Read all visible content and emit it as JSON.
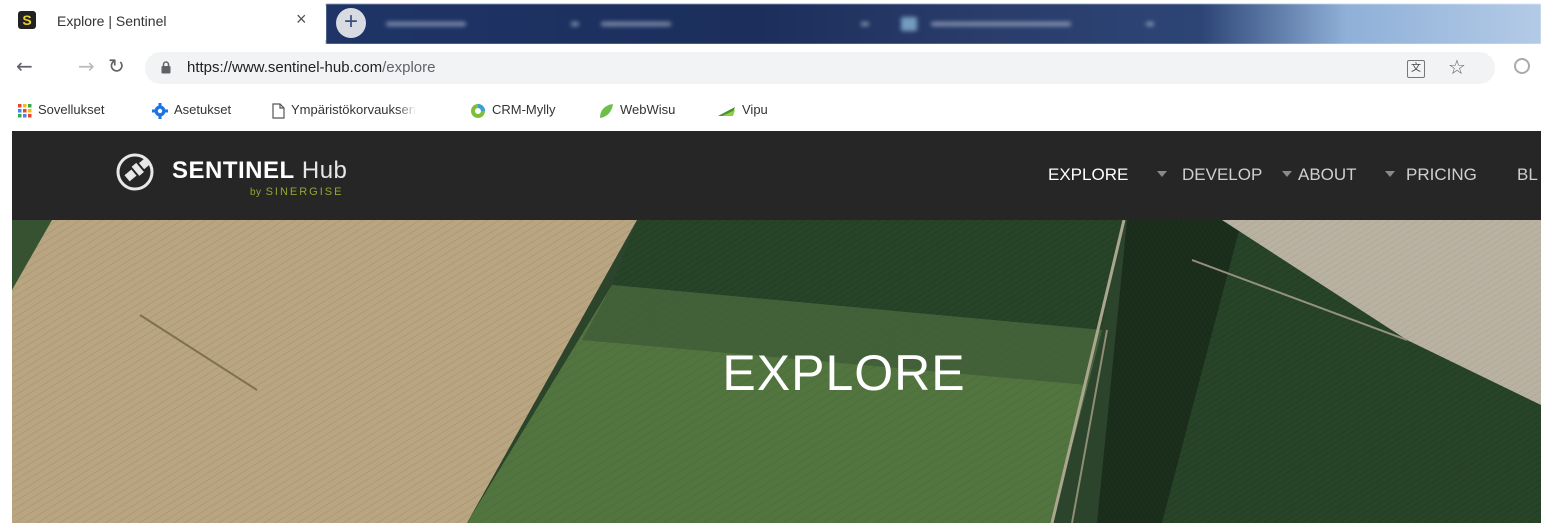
{
  "browser": {
    "tab": {
      "favicon_letter": "S",
      "title": "Explore | Sentinel",
      "close": "×"
    },
    "new_tab": "+",
    "address": {
      "url_host": "https://www.sentinel-hub.com",
      "url_path": "/explore"
    },
    "bookmarks": [
      {
        "label": "Sovellukset",
        "icon": "apps-grid-icon"
      },
      {
        "label": "Asetukset",
        "icon": "gear-icon"
      },
      {
        "label": "Ympäristökorvauksen",
        "icon": "page-icon"
      },
      {
        "label": "CRM-Mylly",
        "icon": "crm-icon"
      },
      {
        "label": "WebWisu",
        "icon": "leaf-icon"
      },
      {
        "label": "Vipu",
        "icon": "vipu-icon"
      }
    ]
  },
  "site": {
    "logo": {
      "bold": "SENTINEL",
      "light": "Hub",
      "by_small": "by",
      "by_brand": "SINERGISE"
    },
    "nav": [
      {
        "label": "EXPLORE",
        "has_caret": true,
        "active": true
      },
      {
        "label": "DEVELOP",
        "has_caret": true
      },
      {
        "label": "ABOUT",
        "has_caret": true
      },
      {
        "label": "PRICING",
        "has_caret": false
      },
      {
        "label": "BL",
        "has_caret": false
      }
    ],
    "hero_title": "EXPLORE"
  },
  "colors": {
    "header_bg": "#262626",
    "brand_green": "#8fa832",
    "tab_favicon": "#e8d02a"
  }
}
